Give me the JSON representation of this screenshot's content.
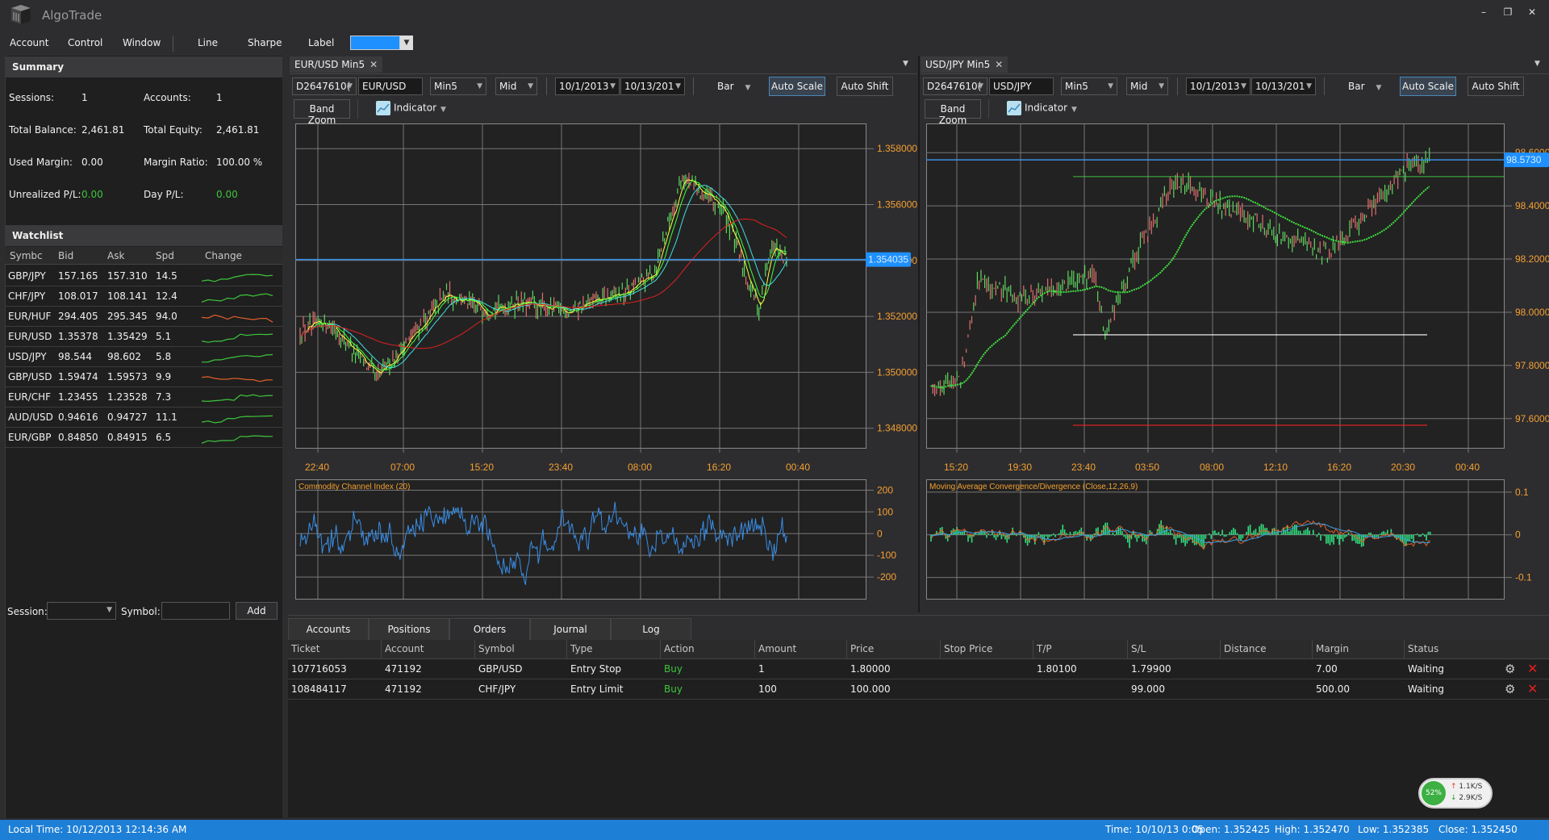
{
  "app": {
    "title": "AlgoTrade"
  },
  "window_controls": {
    "minimize": "–",
    "restore": "❐",
    "close": "✕"
  },
  "menu": {
    "items": [
      "Account",
      "Control",
      "Window"
    ],
    "tools": [
      "Line",
      "Sharpe",
      "Label"
    ],
    "label_color": "#1e90ff"
  },
  "summary": {
    "title": "Summary",
    "sessions_label": "Sessions:",
    "sessions": "1",
    "accounts_label": "Accounts:",
    "accounts": "1",
    "balance_label": "Total Balance:",
    "balance": "2,461.81",
    "equity_label": "Total Equity:",
    "equity": "2,461.81",
    "used_margin_label": "Used Margin:",
    "used_margin": "0.00",
    "margin_ratio_label": "Margin Ratio:",
    "margin_ratio": "100.00 %",
    "upl_label": "Unrealized P/L:",
    "upl": "0.00",
    "dpl_label": "Day P/L:",
    "dpl": "0.00"
  },
  "watchlist": {
    "title": "Watchlist",
    "columns": [
      "Symbc",
      "Bid",
      "Ask",
      "Spd",
      "Change"
    ],
    "rows": [
      {
        "symbol": "GBP/JPY",
        "bid": "157.165",
        "ask": "157.310",
        "spd": "14.5",
        "trend": "up"
      },
      {
        "symbol": "CHF/JPY",
        "bid": "108.017",
        "ask": "108.141",
        "spd": "12.4",
        "trend": "up"
      },
      {
        "symbol": "EUR/HUF",
        "bid": "294.405",
        "ask": "295.345",
        "spd": "94.0",
        "trend": "down"
      },
      {
        "symbol": "EUR/USD",
        "bid": "1.35378",
        "ask": "1.35429",
        "spd": "5.1",
        "trend": "up"
      },
      {
        "symbol": "USD/JPY",
        "bid": "98.544",
        "ask": "98.602",
        "spd": "5.8",
        "trend": "up"
      },
      {
        "symbol": "GBP/USD",
        "bid": "1.59474",
        "ask": "1.59573",
        "spd": "9.9",
        "trend": "down"
      },
      {
        "symbol": "EUR/CHF",
        "bid": "1.23455",
        "ask": "1.23528",
        "spd": "7.3",
        "trend": "up"
      },
      {
        "symbol": "AUD/USD",
        "bid": "0.94616",
        "ask": "0.94727",
        "spd": "11.1",
        "trend": "up"
      },
      {
        "symbol": "EUR/GBP",
        "bid": "0.84850",
        "ask": "0.84915",
        "spd": "6.5",
        "trend": "up"
      }
    ],
    "session_label": "Session:",
    "symbol_label": "Symbol:",
    "add_label": "Add"
  },
  "charts": [
    {
      "tab": "EUR/USD Min5",
      "account": "D2647610(",
      "symbol": "EUR/USD",
      "period": "Min5",
      "price_type": "Mid",
      "from": "10/1/2013",
      "to": "10/13/201",
      "chart_type": "Bar",
      "auto_scale": "Auto Scale",
      "auto_shift": "Auto Shift",
      "band_zoom": "Band Zoom",
      "indicator": "Indicator",
      "y_ticks": [
        "1.358000",
        "1.356000",
        "1.354000",
        "1.352000",
        "1.350000",
        "1.348000"
      ],
      "y_range": [
        1.3473,
        1.3589
      ],
      "current_price": "1.354035",
      "current_value": 1.354035,
      "x_ticks": [
        "22:40",
        "07:00",
        "15:20",
        "23:40",
        "08:00",
        "16:20",
        "00:40"
      ],
      "sub_title": "Commodity Channel Index (20)",
      "sub_ticks": [
        "200",
        "100",
        "0",
        "-100",
        "-200"
      ],
      "sub_range": [
        -300,
        250
      ]
    },
    {
      "tab": "USD/JPY Min5",
      "account": "D2647610(",
      "symbol": "USD/JPY",
      "period": "Min5",
      "price_type": "Mid",
      "from": "10/1/2013",
      "to": "10/13/201",
      "chart_type": "Bar",
      "auto_scale": "Auto Scale",
      "auto_shift": "Auto Shift",
      "band_zoom": "Band Zoom",
      "indicator": "Indicator",
      "y_ticks": [
        "98.6000",
        "98.4000",
        "98.2000",
        "98.0000",
        "97.8000",
        "97.6000"
      ],
      "y_range": [
        97.49,
        98.71
      ],
      "current_price": "98.5730",
      "current_value": 98.573,
      "x_ticks": [
        "15:20",
        "19:30",
        "23:40",
        "03:50",
        "08:00",
        "12:10",
        "16:20",
        "20:30",
        "00:40"
      ],
      "sub_title": "Moving Average Convergence/Divergence (Close,12,26,9)",
      "sub_ticks": [
        "0.1",
        "0",
        "-0.1"
      ],
      "sub_range": [
        -0.15,
        0.13
      ]
    }
  ],
  "orders": {
    "tabs": [
      "Accounts",
      "Positions",
      "Orders",
      "Journal",
      "Log"
    ],
    "active_tab": "Orders",
    "columns": [
      "Ticket",
      "Account",
      "Symbol",
      "Type",
      "Action",
      "Amount",
      "Price",
      "Stop Price",
      "T/P",
      "S/L",
      "Distance",
      "Margin",
      "Status"
    ],
    "rows": [
      {
        "ticket": "107716053",
        "account": "471192",
        "symbol": "GBP/USD",
        "type": "Entry Stop",
        "action": "Buy",
        "amount": "1",
        "price": "1.80000",
        "stop_price": "",
        "tp": "1.80100",
        "sl": "1.79900",
        "distance": "",
        "margin": "7.00",
        "status": "Waiting"
      },
      {
        "ticket": "108484117",
        "account": "471192",
        "symbol": "CHF/JPY",
        "type": "Entry Limit",
        "action": "Buy",
        "amount": "100",
        "price": "100.000",
        "stop_price": "",
        "tp": "",
        "sl": "99.000",
        "distance": "",
        "margin": "500.00",
        "status": "Waiting"
      }
    ]
  },
  "network": {
    "percent": "52%",
    "up": "1.1K/S",
    "down": "2.9K/S"
  },
  "status": {
    "local_time": "Local Time: 10/12/2013 12:14:36 AM",
    "time": "Time: 10/10/13 0:05",
    "open": "Open: 1.352425",
    "high": "High: 1.352470",
    "low": "Low: 1.352385",
    "close": "Close: 1.352450"
  }
}
